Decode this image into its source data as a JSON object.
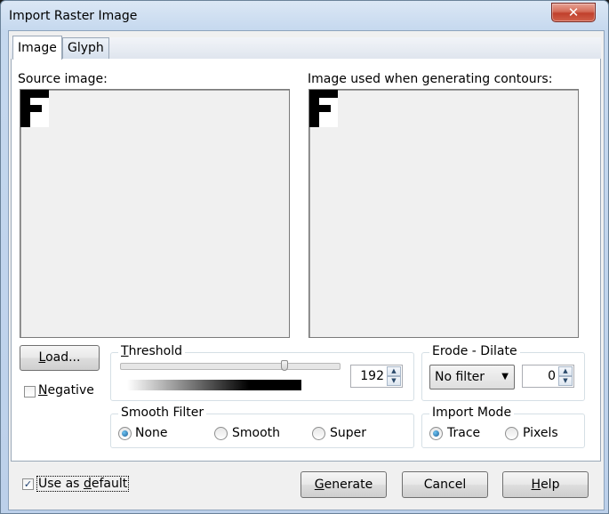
{
  "window": {
    "title": "Import Raster Image",
    "close_glyph": "✕"
  },
  "tabs": [
    {
      "label": "Image",
      "active": true
    },
    {
      "label": "Glyph",
      "active": false
    }
  ],
  "source": {
    "label": "Source image:",
    "glyph": "F"
  },
  "output": {
    "label": "Image used when generating contours:",
    "glyph": "F"
  },
  "load_button": {
    "label_access": "L",
    "label_rest": "oad..."
  },
  "negative": {
    "label_access": "N",
    "label_rest": "egative",
    "checked": false
  },
  "threshold": {
    "title_access": "T",
    "title_rest": "hreshold",
    "value": "192",
    "level": 0.75
  },
  "erode_dilate": {
    "title": "Erode - Dilate",
    "filter_selected": "No filter",
    "value": "0"
  },
  "smooth_filter": {
    "title": "Smooth Filter",
    "options": [
      "None",
      "Smooth",
      "Super"
    ],
    "selected": "None"
  },
  "import_mode": {
    "title": "Import Mode",
    "options": [
      "Trace",
      "Pixels"
    ],
    "selected": "Trace"
  },
  "use_default": {
    "label_pre": "Use as ",
    "label_access": "d",
    "label_rest": "efault",
    "checked": true,
    "check_glyph": "✓"
  },
  "buttons": {
    "generate": {
      "label_access": "G",
      "label_rest": "enerate"
    },
    "cancel": {
      "label": "Cancel"
    },
    "help": {
      "label_access": "H",
      "label_rest": "elp"
    }
  },
  "icons": {
    "spin_up": "▲",
    "spin_down": "▼",
    "dropdown": "▼"
  }
}
